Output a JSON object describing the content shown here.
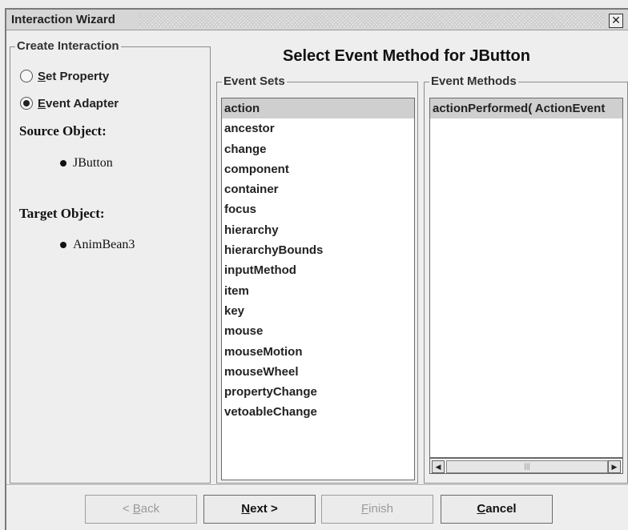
{
  "window": {
    "title": "Interaction Wizard",
    "close_symbol": "✕"
  },
  "left_panel": {
    "group_label": "Create Interaction",
    "options": [
      {
        "label": "Set Property",
        "mnemonic": "S",
        "selected": false
      },
      {
        "label": "Event Adapter",
        "mnemonic": "E",
        "selected": true
      }
    ],
    "source_heading": "Source Object:",
    "source_value": "JButton",
    "target_heading": "Target Object:",
    "target_value": "AnimBean3"
  },
  "main": {
    "heading": "Select Event Method for JButton",
    "event_sets": {
      "label": "Event Sets",
      "selected": "action",
      "items": [
        "action",
        "ancestor",
        "change",
        "component",
        "container",
        "focus",
        "hierarchy",
        "hierarchyBounds",
        "inputMethod",
        "item",
        "key",
        "mouse",
        "mouseMotion",
        "mouseWheel",
        "propertyChange",
        "vetoableChange"
      ]
    },
    "event_methods": {
      "label": "Event Methods",
      "items": [
        "actionPerformed( ActionEvent"
      ]
    }
  },
  "buttons": {
    "back": {
      "pre": "< ",
      "mnemonic": "B",
      "rest": "ack",
      "enabled": false
    },
    "next": {
      "mnemonic": "N",
      "rest": "ext >",
      "enabled": true
    },
    "finish": {
      "mnemonic": "F",
      "rest": "inish",
      "enabled": false
    },
    "cancel": {
      "mnemonic": "C",
      "rest": "ancel",
      "enabled": true
    }
  },
  "scrollbar": {
    "left_arrow": "◀",
    "right_arrow": "▶",
    "grip": "|||"
  }
}
